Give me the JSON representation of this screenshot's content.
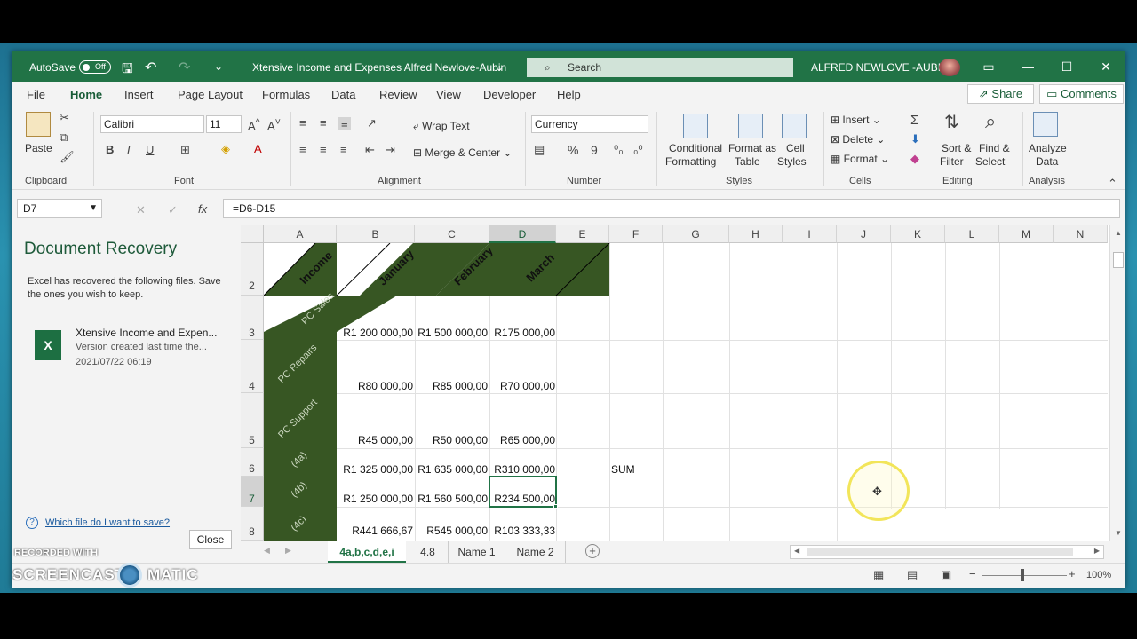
{
  "titlebar": {
    "autosave_label": "AutoSave",
    "autosave_state": "Off",
    "doc_title": "Xtensive Income and Expenses Alfred Newlove-Aubin",
    "search_placeholder": "Search",
    "user_name": "ALFRED NEWLOVE -AUBIN"
  },
  "menu": {
    "items": [
      "File",
      "Home",
      "Insert",
      "Page Layout",
      "Formulas",
      "Data",
      "Review",
      "View",
      "Developer",
      "Help"
    ],
    "share": "Share",
    "comments": "Comments"
  },
  "ribbon": {
    "clipboard": {
      "paste": "Paste",
      "group": "Clipboard"
    },
    "font": {
      "family": "Calibri",
      "size": "11",
      "group": "Font",
      "bold": "B",
      "italic": "I",
      "underline": "U"
    },
    "alignment": {
      "wrap": "Wrap Text",
      "merge": "Merge & Center",
      "group": "Alignment"
    },
    "number": {
      "format": "Currency",
      "percent": "%",
      "comma": "9",
      "group": "Number"
    },
    "styles": {
      "conditional": "Conditional",
      "conditional2": "Formatting",
      "format_as": "Format as",
      "format_as2": "Table",
      "cell": "Cell",
      "cell2": "Styles",
      "group": "Styles"
    },
    "cells": {
      "insert": "Insert",
      "delete": "Delete",
      "format": "Format",
      "group": "Cells"
    },
    "editing": {
      "sort": "Sort &",
      "sort2": "Filter",
      "find": "Find &",
      "find2": "Select",
      "group": "Editing",
      "sigma": "Σ"
    },
    "analysis": {
      "analyze": "Analyze",
      "analyze2": "Data",
      "group": "Analysis"
    }
  },
  "formula_bar": {
    "name_box": "D7",
    "fx": "fx",
    "formula": "=D6-D15"
  },
  "doc_recovery": {
    "title": "Document Recovery",
    "message": "Excel has recovered the following files.  Save the ones you wish to keep.",
    "file_name": "Xtensive Income and Expen...",
    "file_status": "Version created last time the...",
    "file_date": "2021/07/22 06:19",
    "help_link": "Which file do I want to save?",
    "close": "Close"
  },
  "sheet": {
    "columns": [
      "A",
      "B",
      "C",
      "D",
      "E",
      "F",
      "G",
      "H",
      "I",
      "J",
      "K",
      "L",
      "M",
      "N"
    ],
    "rows": [
      "2",
      "3",
      "4",
      "5",
      "6",
      "7",
      "8"
    ],
    "headers": {
      "income": "Income",
      "jan": "January",
      "feb": "February",
      "mar": "March"
    },
    "row_labels": [
      "PC Sales",
      "PC Repairs",
      "PC Support",
      "(4a)",
      "(4b)",
      "(4c)"
    ],
    "data": [
      [
        "R1 200 000,00",
        "R1 500 000,00",
        "R175 000,00"
      ],
      [
        "R80 000,00",
        "R85 000,00",
        "R70 000,00"
      ],
      [
        "R45 000,00",
        "R50 000,00",
        "R65 000,00"
      ],
      [
        "R1 325 000,00",
        "R1 635 000,00",
        "R310 000,00"
      ],
      [
        "R1 250 000,00",
        "R1 560 500,00",
        "R234 500,00"
      ],
      [
        "R441 666,67",
        "R545 000,00",
        "R103 333,33"
      ]
    ],
    "sum_label": "SUM"
  },
  "tabs": [
    "4a,b,c,d,e,i",
    "4.8",
    "Name 1",
    "Name 2"
  ],
  "status": {
    "zoom": "100%"
  },
  "watermark": {
    "line1": "RECORDED WITH",
    "line2": "SCREENCAST",
    "line3": "MATIC"
  },
  "colors": {
    "excel_green": "#217346",
    "header_green": "#375623"
  }
}
